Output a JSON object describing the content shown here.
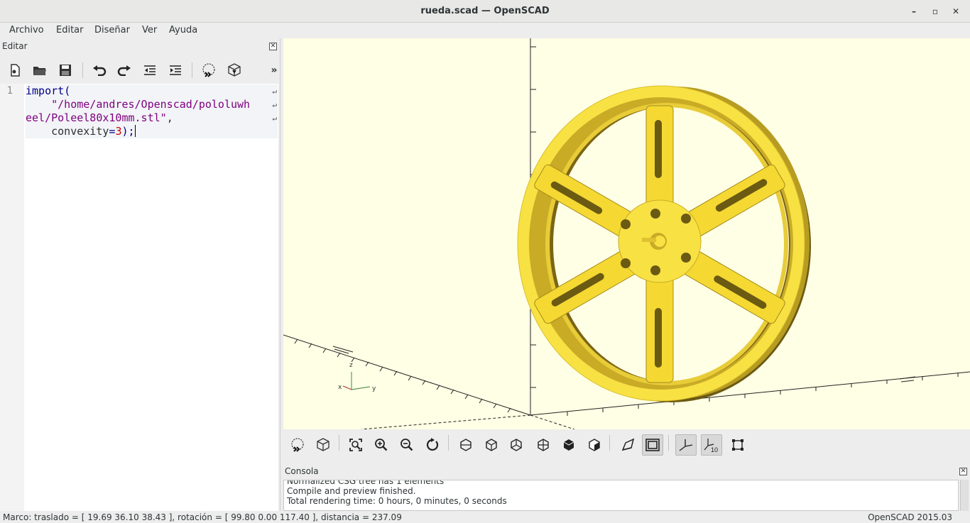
{
  "window": {
    "title": "rueda.scad — OpenSCAD",
    "minimize_glyph": "–",
    "maximize_glyph": "▫",
    "close_glyph": "✕"
  },
  "menubar": {
    "items": [
      "Archivo",
      "Editar",
      "Diseñar",
      "Ver",
      "Ayuda"
    ]
  },
  "editor": {
    "title": "Editar",
    "close_glyph": "✕",
    "overflow_glyph": "»",
    "toolbar_icons": [
      "new-file-icon",
      "open-file-icon",
      "save-icon",
      "undo-icon",
      "redo-icon",
      "unindent-icon",
      "indent-icon",
      "preview-icon",
      "render-icon"
    ],
    "line_number": "1",
    "code": {
      "l1_kw": "import",
      "l1_paren": "(",
      "l2_str": "\"/home/andres/Openscad/pololuwh",
      "l3_str": "eel/Poleel80x10mm.stl\"",
      "l3_comma": ",",
      "l4_ident": "convexity",
      "l4_eq": "=",
      "l4_num": "3",
      "l4_end": ");"
    },
    "wrap_glyph": "↵"
  },
  "viewer": {
    "axis_labels": {
      "z": "z",
      "x": "x",
      "y": "y",
      "tick": "10"
    },
    "model_color": "#f8e143",
    "background_color": "#ffffe5",
    "toolbar_icons": [
      "preview-icon",
      "render-icon",
      "view-all-icon",
      "zoom-in-icon",
      "zoom-out-icon",
      "reset-view-icon",
      "view-right-icon",
      "view-top-icon",
      "view-bottom-icon",
      "view-left-icon",
      "view-front-icon",
      "view-back-icon",
      "perspective-icon",
      "orthogonal-icon",
      "show-axes-icon",
      "show-scale-markers-icon",
      "show-edges-icon"
    ]
  },
  "console": {
    "title": "Consola",
    "close_glyph": "✕",
    "lines": [
      "Normalized CSG tree has 1 elements",
      "Compile and preview finished.",
      "Total rendering time: 0 hours, 0 minutes, 0 seconds"
    ]
  },
  "statusbar": {
    "left": "Marco: traslado = [ 19.69 36.10 38.43 ], rotación = [ 99.80 0.00 117.40 ], distancia = 237.09",
    "right": "OpenSCAD 2015.03"
  }
}
